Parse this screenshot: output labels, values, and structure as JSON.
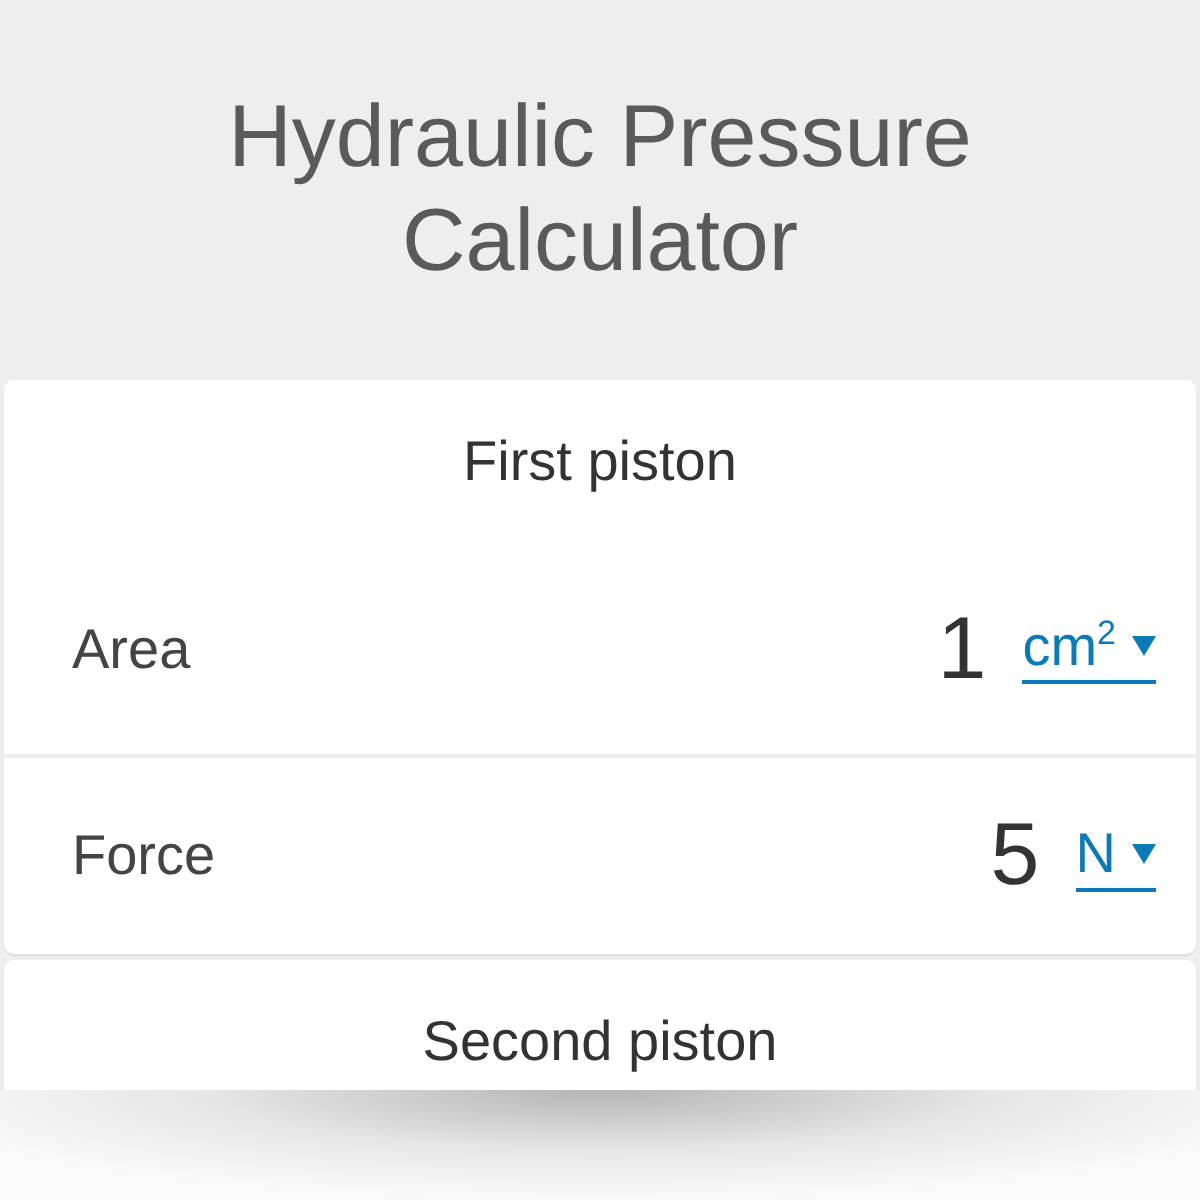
{
  "title": "Hydraulic Pressure Calculator",
  "sections": [
    {
      "heading": "First piston",
      "fields": [
        {
          "label": "Area",
          "value": "1",
          "unit": "cm$^{2}$"
        },
        {
          "label": "Force",
          "value": "5",
          "unit": "N"
        }
      ]
    },
    {
      "heading": "Second piston"
    }
  ]
}
